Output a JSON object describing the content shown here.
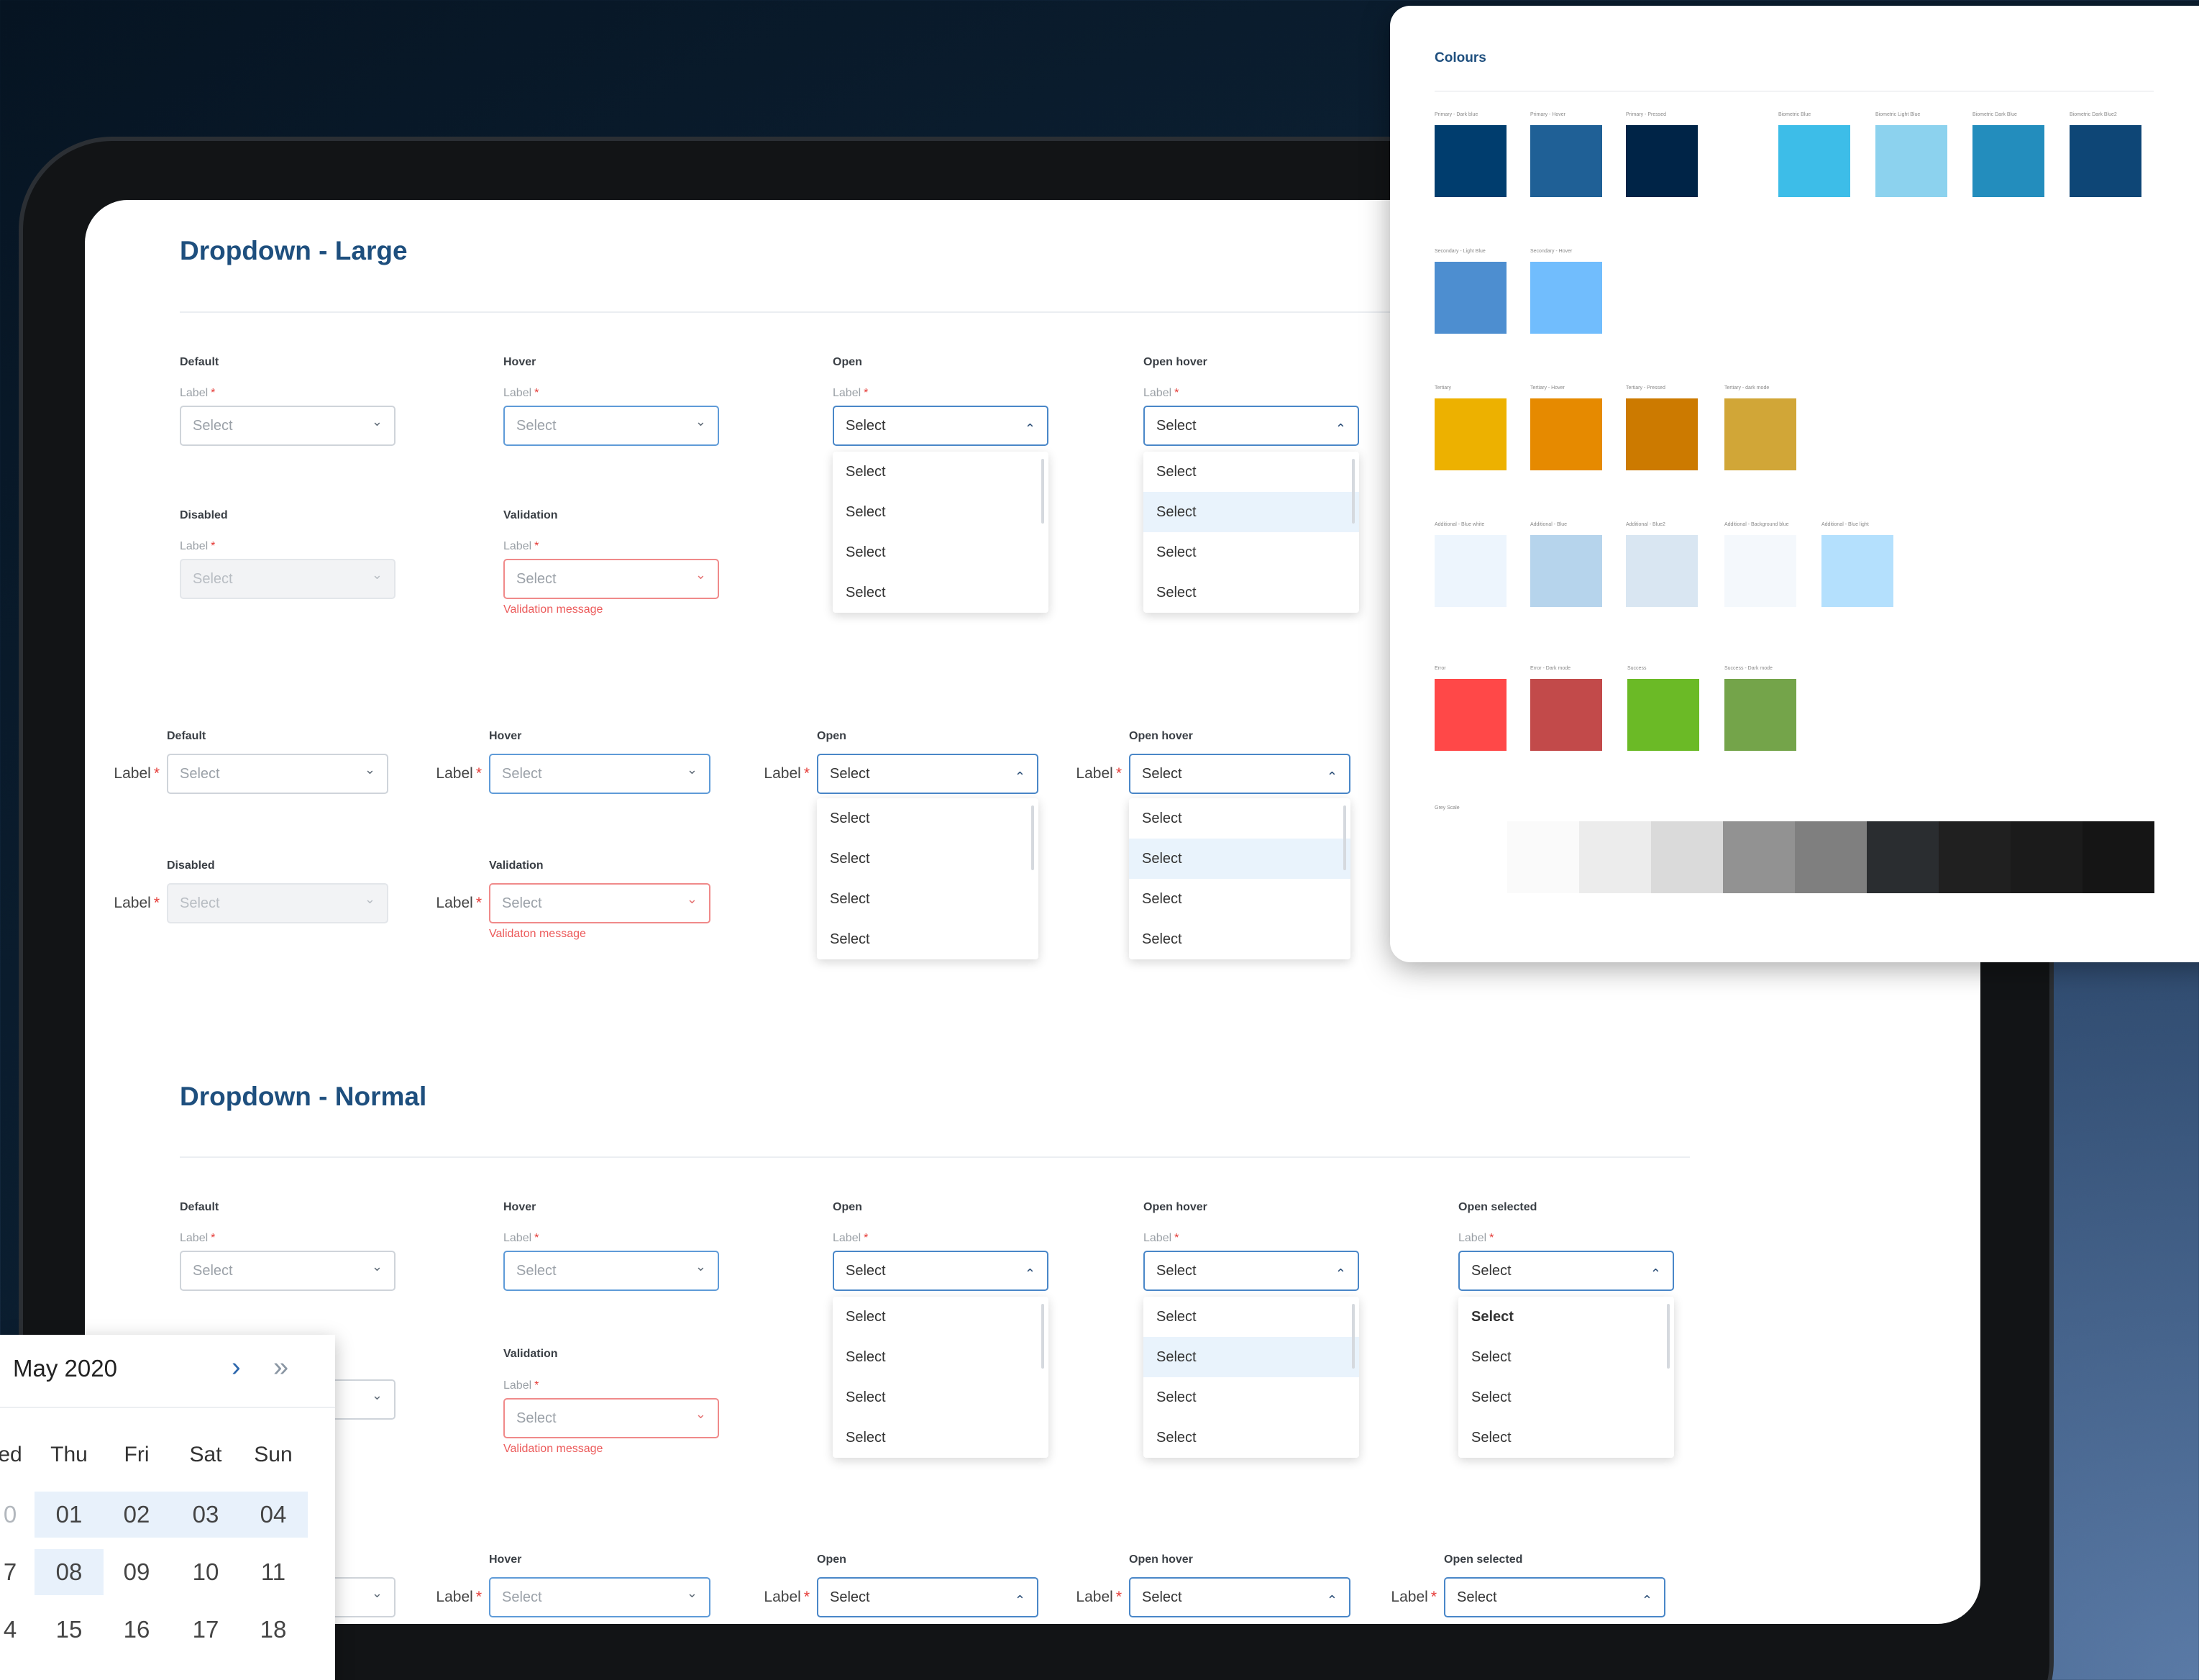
{
  "large": {
    "title": "Dropdown - Large",
    "stacked": [
      {
        "state": "Default",
        "label": "Label",
        "value": "Select",
        "variant": "default"
      },
      {
        "state": "Hover",
        "label": "Label",
        "value": "Select",
        "variant": "hover"
      },
      {
        "state": "Open",
        "label": "Label",
        "value": "Select",
        "variant": "open",
        "options": [
          "Select",
          "Select",
          "Select",
          "Select"
        ]
      },
      {
        "state": "Open hover",
        "label": "Label",
        "value": "Select",
        "variant": "open",
        "options": [
          "Select",
          "Select",
          "Select",
          "Select"
        ],
        "highlight": 1
      },
      {
        "state": "Disabled",
        "label": "Label",
        "value": "Select",
        "variant": "disabled"
      },
      {
        "state": "Validation",
        "label": "Label",
        "value": "Select",
        "variant": "invalid",
        "message": "Validation message"
      }
    ],
    "inline": [
      {
        "state": "Default",
        "label": "Label",
        "value": "Select",
        "variant": "default"
      },
      {
        "state": "Hover",
        "label": "Label",
        "value": "Select",
        "variant": "hover"
      },
      {
        "state": "Open",
        "label": "Label",
        "value": "Select",
        "variant": "open",
        "options": [
          "Select",
          "Select",
          "Select",
          "Select"
        ]
      },
      {
        "state": "Open hover",
        "label": "Label",
        "value": "Select",
        "variant": "open",
        "options": [
          "Select",
          "Select",
          "Select",
          "Select"
        ],
        "highlight": 1
      },
      {
        "state": "Disabled",
        "label": "Label",
        "value": "Select",
        "variant": "disabled"
      },
      {
        "state": "Validation",
        "label": "Label",
        "value": "Select",
        "variant": "invalid",
        "message": "Validaton message"
      }
    ]
  },
  "normal": {
    "title": "Dropdown - Normal",
    "stacked": [
      {
        "state": "Default",
        "label": "Label",
        "value": "Select",
        "variant": "default"
      },
      {
        "state": "Hover",
        "label": "Label",
        "value": "Select",
        "variant": "hover"
      },
      {
        "state": "Open",
        "label": "Label",
        "value": "Select",
        "variant": "open",
        "options": [
          "Select",
          "Select",
          "Select",
          "Select"
        ]
      },
      {
        "state": "Open hover",
        "label": "Label",
        "value": "Select",
        "variant": "open",
        "options": [
          "Select",
          "Select",
          "Select",
          "Select"
        ],
        "highlight": 1
      },
      {
        "state": "Open selected",
        "label": "Label",
        "value": "Select",
        "variant": "open",
        "options": [
          "Select",
          "Select",
          "Select",
          "Select"
        ],
        "selected": 0
      },
      {
        "state": "",
        "label": "",
        "value": "",
        "variant": "default"
      },
      {
        "state": "Validation",
        "label": "Label",
        "value": "Select",
        "variant": "invalid",
        "message": "Validation message"
      }
    ],
    "inline": [
      {
        "state": "",
        "label": "",
        "value": "",
        "variant": "default"
      },
      {
        "state": "Hover",
        "label": "Label",
        "value": "Select",
        "variant": "hover"
      },
      {
        "state": "Open",
        "label": "Label",
        "value": "Select",
        "variant": "open"
      },
      {
        "state": "Open hover",
        "label": "Label",
        "value": "Select",
        "variant": "open"
      },
      {
        "state": "Open selected",
        "label": "Label",
        "value": "Select",
        "variant": "open"
      }
    ]
  },
  "colours": {
    "title": "Colours",
    "rows": [
      [
        {
          "name": "Primary - Dark blue",
          "hex": "#003d6e"
        },
        {
          "name": "Primary - Hover",
          "hex": "#1f6096"
        },
        {
          "name": "Primary - Pressed",
          "hex": "#002447"
        },
        {
          "name": "Biometric Blue",
          "hex": "#3dbde8"
        },
        {
          "name": "Biometric Light Blue",
          "hex": "#8cd2ee"
        },
        {
          "name": "Biometric Dark Blue",
          "hex": "#238dbd"
        },
        {
          "name": "Biometric Dark Blue2",
          "hex": "#0e4676"
        }
      ],
      [
        {
          "name": "Secondary - Light Blue",
          "hex": "#4d8ed0"
        },
        {
          "name": "Secondary - Hover",
          "hex": "#71bdfd"
        }
      ],
      [
        {
          "name": "Tertiary",
          "hex": "#edb100"
        },
        {
          "name": "Tertiary - Hover",
          "hex": "#e68a00"
        },
        {
          "name": "Tertiary - Pressed",
          "hex": "#cc7a00"
        },
        {
          "name": "Tertiary - dark mode",
          "hex": "#d1a637"
        }
      ],
      [
        {
          "name": "Additional - Blue white",
          "hex": "#edf5fd"
        },
        {
          "name": "Additional - Blue",
          "hex": "#b6d4ec"
        },
        {
          "name": "Additional - Blue2",
          "hex": "#d9e6f2"
        },
        {
          "name": "Additional - Background blue",
          "hex": "#f4f8fc"
        },
        {
          "name": "Additional - Blue light",
          "hex": "#b4e0fd"
        }
      ],
      [
        {
          "name": "Error",
          "hex": "#ff4848"
        },
        {
          "name": "Error - Dark mode",
          "hex": "#c24a4a"
        },
        {
          "name": "Success",
          "hex": "#6bba26"
        },
        {
          "name": "Success - Dark mode",
          "hex": "#74a44a"
        }
      ]
    ],
    "greys_label": "Grey Scale",
    "greys": [
      "#fafafa",
      "#ececec",
      "#dadada",
      "#929292",
      "#7f7f7f",
      "#2a2d30",
      "#202020",
      "#1b1b1b",
      "#151515"
    ]
  },
  "calendar": {
    "month": "May 2020",
    "next_icon": "chevron-right-icon",
    "next_year_icon": "double-chevron-right-icon",
    "weekdays": [
      "ed",
      "Thu",
      "Fri",
      "Sat",
      "Sun"
    ],
    "weeks": [
      [
        "0",
        "01",
        "02",
        "03",
        "04"
      ],
      [
        "7",
        "08",
        "09",
        "10",
        "11"
      ],
      [
        "4",
        "15",
        "16",
        "17",
        "18"
      ]
    ]
  }
}
